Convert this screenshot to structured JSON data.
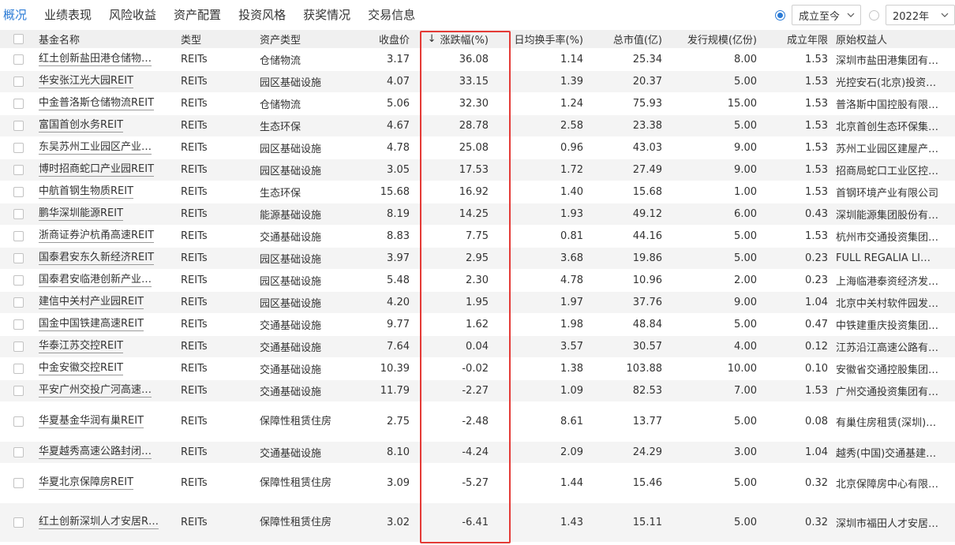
{
  "tabs": [
    {
      "label": "概况",
      "active": true
    },
    {
      "label": "业绩表现",
      "active": false
    },
    {
      "label": "风险收益",
      "active": false
    },
    {
      "label": "资产配置",
      "active": false
    },
    {
      "label": "投资风格",
      "active": false
    },
    {
      "label": "获奖情况",
      "active": false
    },
    {
      "label": "交易信息",
      "active": false
    }
  ],
  "controls": {
    "period_select": "成立至今",
    "year_select": "2022年"
  },
  "columns": [
    "基金名称",
    "类型",
    "资产类型",
    "收盘价",
    "涨跌幅(%)",
    "日均换手率(%)",
    "总市值(亿)",
    "发行规模(亿份)",
    "成立年限",
    "原始权益人"
  ],
  "rows": [
    {
      "name": "红土创新盐田港仓储物…",
      "type": "REITs",
      "asset": "仓储物流",
      "close": "3.17",
      "change": "36.08",
      "turnover": "1.14",
      "mktcap": "25.34",
      "issue": "8.00",
      "years": "1.53",
      "owner": "深圳市盐田港集团有…"
    },
    {
      "name": "华安张江光大园REIT",
      "type": "REITs",
      "asset": "园区基础设施",
      "close": "4.07",
      "change": "33.15",
      "turnover": "1.39",
      "mktcap": "20.37",
      "issue": "5.00",
      "years": "1.53",
      "owner": "光控安石(北京)投资…"
    },
    {
      "name": "中金普洛斯仓储物流REIT",
      "type": "REITs",
      "asset": "仓储物流",
      "close": "5.06",
      "change": "32.30",
      "turnover": "1.24",
      "mktcap": "75.93",
      "issue": "15.00",
      "years": "1.53",
      "owner": "普洛斯中国控股有限…"
    },
    {
      "name": "富国首创水务REIT",
      "type": "REITs",
      "asset": "生态环保",
      "close": "4.67",
      "change": "28.78",
      "turnover": "2.58",
      "mktcap": "23.38",
      "issue": "5.00",
      "years": "1.53",
      "owner": "北京首创生态环保集…"
    },
    {
      "name": "东吴苏州工业园区产业…",
      "type": "REITs",
      "asset": "园区基础设施",
      "close": "4.78",
      "change": "25.08",
      "turnover": "0.96",
      "mktcap": "43.03",
      "issue": "9.00",
      "years": "1.53",
      "owner": "苏州工业园区建屋产…"
    },
    {
      "name": "博时招商蛇口产业园REIT",
      "type": "REITs",
      "asset": "园区基础设施",
      "close": "3.05",
      "change": "17.53",
      "turnover": "1.72",
      "mktcap": "27.49",
      "issue": "9.00",
      "years": "1.53",
      "owner": "招商局蛇口工业区控…"
    },
    {
      "name": "中航首钢生物质REIT",
      "type": "REITs",
      "asset": "生态环保",
      "close": "15.68",
      "change": "16.92",
      "turnover": "1.40",
      "mktcap": "15.68",
      "issue": "1.00",
      "years": "1.53",
      "owner": "首钢环境产业有限公司"
    },
    {
      "name": "鹏华深圳能源REIT",
      "type": "REITs",
      "asset": "能源基础设施",
      "close": "8.19",
      "change": "14.25",
      "turnover": "1.93",
      "mktcap": "49.12",
      "issue": "6.00",
      "years": "0.43",
      "owner": "深圳能源集团股份有…"
    },
    {
      "name": "浙商证券沪杭甬高速REIT",
      "type": "REITs",
      "asset": "交通基础设施",
      "close": "8.83",
      "change": "7.75",
      "turnover": "0.81",
      "mktcap": "44.16",
      "issue": "5.00",
      "years": "1.53",
      "owner": "杭州市交通投资集团…"
    },
    {
      "name": "国泰君安东久新经济REIT",
      "type": "REITs",
      "asset": "园区基础设施",
      "close": "3.97",
      "change": "2.95",
      "turnover": "3.68",
      "mktcap": "19.86",
      "issue": "5.00",
      "years": "0.23",
      "owner": "FULL REGALIA LI…"
    },
    {
      "name": "国泰君安临港创新产业…",
      "type": "REITs",
      "asset": "园区基础设施",
      "close": "5.48",
      "change": "2.30",
      "turnover": "4.78",
      "mktcap": "10.96",
      "issue": "2.00",
      "years": "0.23",
      "owner": "上海临港泰资经济发…"
    },
    {
      "name": "建信中关村产业园REIT",
      "type": "REITs",
      "asset": "园区基础设施",
      "close": "4.20",
      "change": "1.95",
      "turnover": "1.97",
      "mktcap": "37.76",
      "issue": "9.00",
      "years": "1.04",
      "owner": "北京中关村软件园发…"
    },
    {
      "name": "国金中国铁建高速REIT",
      "type": "REITs",
      "asset": "交通基础设施",
      "close": "9.77",
      "change": "1.62",
      "turnover": "1.98",
      "mktcap": "48.84",
      "issue": "5.00",
      "years": "0.47",
      "owner": "中铁建重庆投资集团…"
    },
    {
      "name": "华泰江苏交控REIT",
      "type": "REITs",
      "asset": "交通基础设施",
      "close": "7.64",
      "change": "0.04",
      "turnover": "3.57",
      "mktcap": "30.57",
      "issue": "4.00",
      "years": "0.12",
      "owner": "江苏沿江高速公路有…"
    },
    {
      "name": "中金安徽交控REIT",
      "type": "REITs",
      "asset": "交通基础设施",
      "close": "10.39",
      "change": "-0.02",
      "turnover": "1.38",
      "mktcap": "103.88",
      "issue": "10.00",
      "years": "0.10",
      "owner": "安徽省交通控股集团…"
    },
    {
      "name": "平安广州交投广河高速…",
      "type": "REITs",
      "asset": "交通基础设施",
      "close": "11.79",
      "change": "-2.27",
      "turnover": "1.09",
      "mktcap": "82.53",
      "issue": "7.00",
      "years": "1.53",
      "owner": "广州交通投资集团有…"
    },
    {
      "name": "华夏基金华润有巢REIT",
      "type": "REITs",
      "asset": "保障性租赁住房",
      "close": "2.75",
      "change": "-2.48",
      "turnover": "8.61",
      "mktcap": "13.77",
      "issue": "5.00",
      "years": "0.08",
      "owner": "有巢住房租赁(深圳)…"
    },
    {
      "name": "华夏越秀高速公路封闭…",
      "type": "REITs",
      "asset": "交通基础设施",
      "close": "8.10",
      "change": "-4.24",
      "turnover": "2.09",
      "mktcap": "24.29",
      "issue": "3.00",
      "years": "1.04",
      "owner": "越秀(中国)交通基建…"
    },
    {
      "name": "华夏北京保障房REIT",
      "type": "REITs",
      "asset": "保障性租赁住房",
      "close": "3.09",
      "change": "-5.27",
      "turnover": "1.44",
      "mktcap": "15.46",
      "issue": "5.00",
      "years": "0.32",
      "owner": "北京保障房中心有限…"
    },
    {
      "name": "红土创新深圳人才安居R…",
      "type": "REITs",
      "asset": "保障性租赁住房",
      "close": "3.02",
      "change": "-6.41",
      "turnover": "1.43",
      "mktcap": "15.11",
      "issue": "5.00",
      "years": "0.32",
      "owner": "深圳市福田人才安居…"
    }
  ],
  "sort_indicator": "down-arrow-icon",
  "highlight_color": "#e43a36",
  "accent_color": "#2b7bd6"
}
